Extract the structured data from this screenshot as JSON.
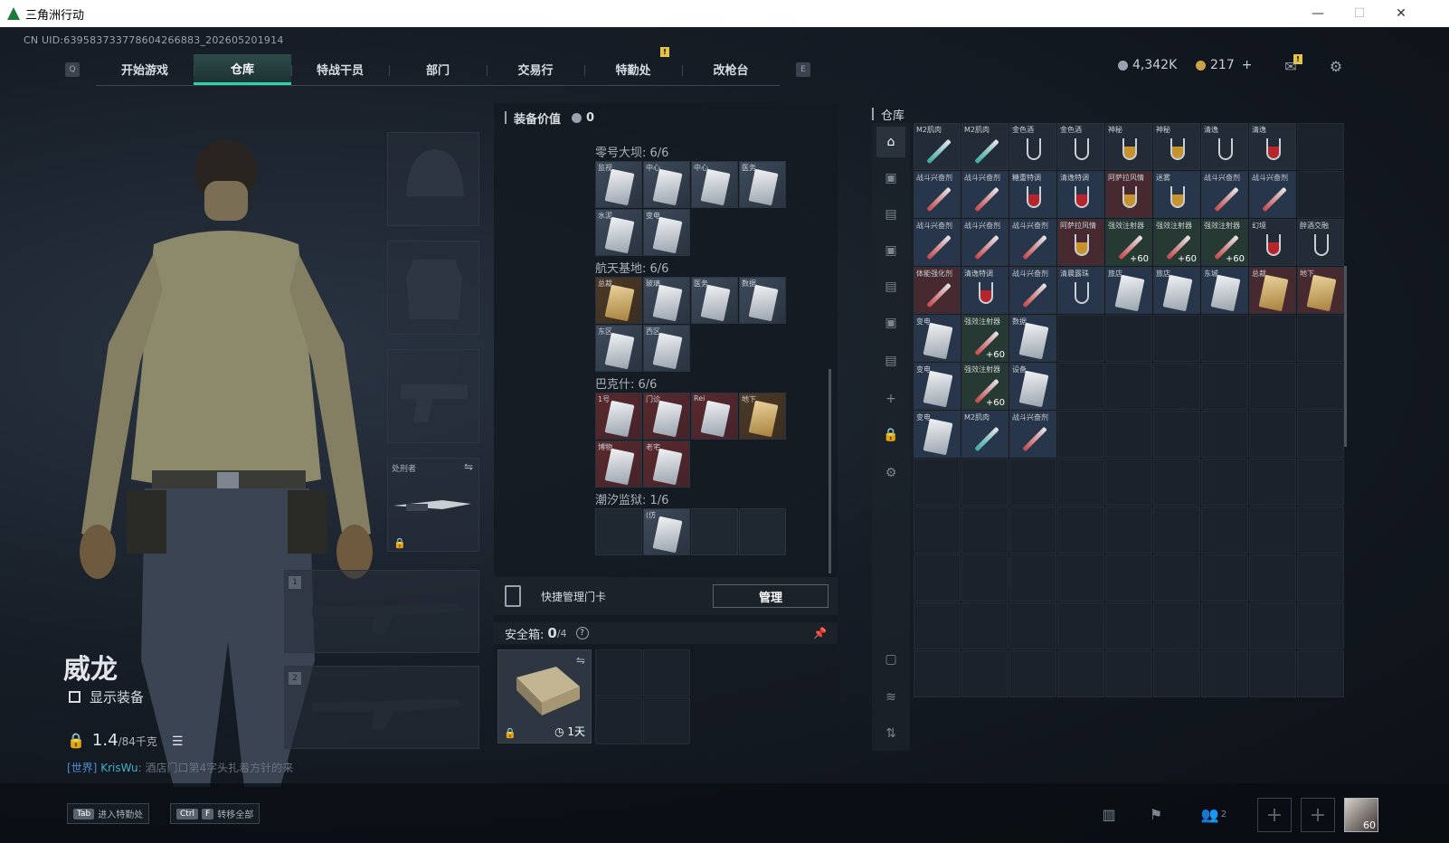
{
  "window": {
    "title": "三角洲行动",
    "min": "—",
    "max": "☐",
    "close": "✕"
  },
  "uid": "CN UID:639583733778604266883_202605201914",
  "nav": {
    "key_left": "Q",
    "key_right": "E",
    "tabs": [
      "开始游戏",
      "仓库",
      "特战干员",
      "部门",
      "交易行",
      "特勤处",
      "改枪台"
    ],
    "active": "仓库",
    "badge": "!"
  },
  "currency": {
    "silver": "4,342K",
    "gold": "217",
    "plus": "+",
    "mail_badge": "!"
  },
  "character": {
    "name": "威龙",
    "show_gear": "显示装备",
    "weight": "1.4",
    "weight_max": "/84千克",
    "chat_channel": "[世界]",
    "chat_user": "KrisWu",
    "chat_text": "酒店门口第4字头扎着方针的来"
  },
  "slots": {
    "melee_label": "处刑者",
    "slot1": "1",
    "slot2": "2"
  },
  "equipment": {
    "header": "装备价值",
    "value": "0",
    "sections": [
      {
        "title": "零号大坝: 6/6",
        "cards": [
          {
            "label": "监视",
            "tier": "normal"
          },
          {
            "label": "中心",
            "tier": "normal"
          },
          {
            "label": "中心",
            "tier": "normal"
          },
          {
            "label": "医务",
            "tier": "normal"
          },
          {
            "label": "水泥",
            "tier": "normal"
          },
          {
            "label": "变电",
            "tier": "normal"
          }
        ]
      },
      {
        "title": "航天基地: 6/6",
        "cards": [
          {
            "label": "总裁",
            "tier": "gold"
          },
          {
            "label": "玻璃",
            "tier": "normal"
          },
          {
            "label": "医务",
            "tier": "normal"
          },
          {
            "label": "数据",
            "tier": "normal"
          },
          {
            "label": "东区",
            "tier": "normal"
          },
          {
            "label": "西区",
            "tier": "normal"
          }
        ]
      },
      {
        "title": "巴克什: 6/6",
        "cards": [
          {
            "label": "1号",
            "tier": "red"
          },
          {
            "label": "门诊",
            "tier": "red"
          },
          {
            "label": "Rei",
            "tier": "red"
          },
          {
            "label": "地下",
            "tier": "gold"
          },
          {
            "label": "博物",
            "tier": "red"
          },
          {
            "label": "老宅",
            "tier": "red"
          }
        ]
      },
      {
        "title": "潮汐监狱: 1/6",
        "cards": [
          {
            "label": "",
            "tier": "empty"
          },
          {
            "label": "(仿",
            "tier": "normal"
          },
          {
            "label": "",
            "tier": "empty"
          },
          {
            "label": "",
            "tier": "empty"
          }
        ]
      }
    ],
    "quick_label": "快捷管理门卡",
    "manage_button": "管理",
    "safe_label": "安全箱:",
    "safe_count": "0",
    "safe_max": "/4",
    "safe_help": "?",
    "safe_time": "1天"
  },
  "warehouse": {
    "title": "仓库",
    "items": [
      {
        "label": "M2肌肉",
        "kind": "syr-teal",
        "bg": ""
      },
      {
        "label": "M2肌肉",
        "kind": "syr-teal",
        "bg": ""
      },
      {
        "label": "金色酒",
        "kind": "glass",
        "bg": ""
      },
      {
        "label": "金色酒",
        "kind": "glass",
        "bg": ""
      },
      {
        "label": "神秘",
        "kind": "glass-amb",
        "bg": ""
      },
      {
        "label": "神秘",
        "kind": "glass-amb",
        "bg": ""
      },
      {
        "label": "清逸",
        "kind": "glass",
        "bg": ""
      },
      {
        "label": "清逸",
        "kind": "glass-fill",
        "bg": ""
      },
      {
        "label": "",
        "kind": "none",
        "bg": "empty"
      },
      {
        "label": "战斗兴奋剂",
        "kind": "syr",
        "bg": "blue"
      },
      {
        "label": "战斗兴奋剂",
        "kind": "syr",
        "bg": "blue"
      },
      {
        "label": "糖重特调",
        "kind": "glass-fill",
        "bg": "blue"
      },
      {
        "label": "清逸特调",
        "kind": "glass-fill",
        "bg": "blue"
      },
      {
        "label": "阿萨拉风情",
        "kind": "glass-amb",
        "bg": "red"
      },
      {
        "label": "迷雾",
        "kind": "glass-amb",
        "bg": "blue"
      },
      {
        "label": "战斗兴奋剂",
        "kind": "syr",
        "bg": "blue"
      },
      {
        "label": "战斗兴奋剂",
        "kind": "syr",
        "bg": "blue"
      },
      {
        "label": "",
        "kind": "none",
        "bg": "empty"
      },
      {
        "label": "战斗兴奋剂",
        "kind": "syr",
        "bg": "blue"
      },
      {
        "label": "战斗兴奋剂",
        "kind": "syr",
        "bg": "blue"
      },
      {
        "label": "战斗兴奋剂",
        "kind": "syr",
        "bg": "blue"
      },
      {
        "label": "阿萨拉风情",
        "kind": "glass-amb",
        "bg": "red"
      },
      {
        "label": "强效注射器",
        "kind": "syr",
        "bg": "green",
        "extra": "+60"
      },
      {
        "label": "强效注射器",
        "kind": "syr",
        "bg": "green",
        "extra": "+60"
      },
      {
        "label": "强效注射器",
        "kind": "syr",
        "bg": "green",
        "extra": "+60"
      },
      {
        "label": "幻境",
        "kind": "glass-fill",
        "bg": ""
      },
      {
        "label": "醉酒交融",
        "kind": "glass",
        "bg": ""
      },
      {
        "label": "体能强化剂",
        "kind": "syr",
        "bg": "red"
      },
      {
        "label": "清逸特调",
        "kind": "glass-fill",
        "bg": "blue"
      },
      {
        "label": "战斗兴奋剂",
        "kind": "syr",
        "bg": "blue"
      },
      {
        "label": "清晨露珠",
        "kind": "glass",
        "bg": "blue"
      },
      {
        "label": "旅店",
        "kind": "kc",
        "bg": "blue"
      },
      {
        "label": "旅店",
        "kind": "kc",
        "bg": "blue"
      },
      {
        "label": "东城",
        "kind": "kc",
        "bg": "blue"
      },
      {
        "label": "总裁",
        "kind": "kc-gold",
        "bg": "red"
      },
      {
        "label": "地下",
        "kind": "kc-gold",
        "bg": "red"
      },
      {
        "label": "变电",
        "kind": "kc",
        "bg": "blue"
      },
      {
        "label": "强效注射器",
        "kind": "syr",
        "bg": "green",
        "extra": "+60"
      },
      {
        "label": "数据",
        "kind": "kc",
        "bg": "blue"
      },
      {
        "label": "",
        "kind": "none",
        "bg": "empty"
      },
      {
        "label": "",
        "kind": "none",
        "bg": "empty"
      },
      {
        "label": "",
        "kind": "none",
        "bg": "empty"
      },
      {
        "label": "",
        "kind": "none",
        "bg": "empty"
      },
      {
        "label": "",
        "kind": "none",
        "bg": "empty"
      },
      {
        "label": "",
        "kind": "none",
        "bg": "empty"
      },
      {
        "label": "变电",
        "kind": "kc",
        "bg": "blue"
      },
      {
        "label": "强效注射器",
        "kind": "syr",
        "bg": "green",
        "extra": "+60"
      },
      {
        "label": "设备",
        "kind": "kc",
        "bg": "blue"
      },
      {
        "label": "",
        "kind": "none",
        "bg": "empty"
      },
      {
        "label": "",
        "kind": "none",
        "bg": "empty"
      },
      {
        "label": "",
        "kind": "none",
        "bg": "empty"
      },
      {
        "label": "",
        "kind": "none",
        "bg": "empty"
      },
      {
        "label": "",
        "kind": "none",
        "bg": "empty"
      },
      {
        "label": "",
        "kind": "none",
        "bg": "empty"
      },
      {
        "label": "变电",
        "kind": "kc",
        "bg": "blue"
      },
      {
        "label": "M2肌肉",
        "kind": "syr-teal",
        "bg": "blue"
      },
      {
        "label": "战斗兴奋剂",
        "kind": "syr",
        "bg": "blue"
      },
      {
        "label": "",
        "kind": "none",
        "bg": "empty"
      },
      {
        "label": "",
        "kind": "none",
        "bg": "empty"
      },
      {
        "label": "",
        "kind": "none",
        "bg": "empty"
      },
      {
        "label": "",
        "kind": "none",
        "bg": "empty"
      },
      {
        "label": "",
        "kind": "none",
        "bg": "empty"
      },
      {
        "label": "",
        "kind": "none",
        "bg": "empty"
      }
    ]
  },
  "bottom": {
    "hint1_key": "Tab",
    "hint1_text": "进入特勤处",
    "hint2_key1": "Ctrl",
    "hint2_key2": "F",
    "hint2_text": "转移全部",
    "friends_count": "2",
    "avatar_level": "60"
  }
}
